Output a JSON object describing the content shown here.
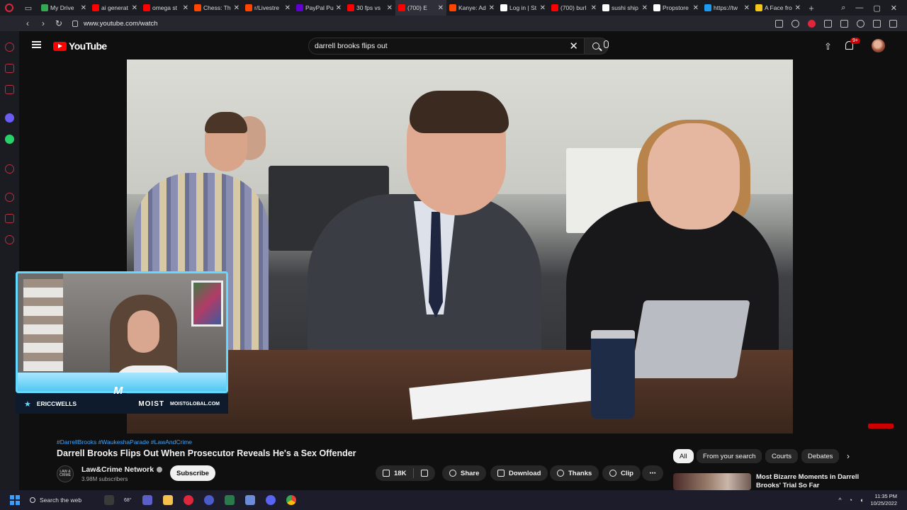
{
  "browser": {
    "tabs": [
      {
        "label": "My Drive",
        "color": "#34a853",
        "active": false
      },
      {
        "label": "ai generat",
        "color": "#ff0000",
        "active": false
      },
      {
        "label": "omega st",
        "color": "#ff0000",
        "active": false
      },
      {
        "label": "Chess: Th",
        "color": "#ff4500",
        "active": false
      },
      {
        "label": "r/Livestre",
        "color": "#ff4500",
        "active": false
      },
      {
        "label": "PayPal Pu",
        "color": "#6001d2",
        "active": false
      },
      {
        "label": "30 fps vs",
        "color": "#ff0000",
        "active": false
      },
      {
        "label": "(700) E",
        "color": "#ff0000",
        "active": true
      },
      {
        "label": "Kanye: Ad",
        "color": "#ff4500",
        "active": false
      },
      {
        "label": "Log in | St",
        "color": "#ffffff",
        "active": false
      },
      {
        "label": "(700) burl",
        "color": "#ff0000",
        "active": false
      },
      {
        "label": "sushi ship",
        "color": "#ffffff",
        "active": false
      },
      {
        "label": "Propstore",
        "color": "#ffffff",
        "active": false
      },
      {
        "label": "https://tw",
        "color": "#1d9bf0",
        "active": false
      },
      {
        "label": "A Face fro",
        "color": "#f5c518",
        "active": false
      }
    ],
    "url": "www.youtube.com/watch"
  },
  "youtube": {
    "logo_text": "YouTube",
    "search_query": "darrell brooks flips out",
    "notification_count": "9+"
  },
  "overlay": {
    "handle": "ERICCWELLS",
    "brand": "MOIST",
    "site": "MOISTGLOBAL.COM",
    "logo_letter": "M"
  },
  "video": {
    "hashtags": "#DarrellBrooks #WaukeshaParade #LawAndCrime",
    "title": "Darrell Brooks Flips Out When Prosecutor Reveals He's a Sex Offender",
    "channel_name": "Law&Crime Network",
    "channel_avatar_text": "LAW & CRIME",
    "subscribers": "3.98M subscribers",
    "subscribe_label": "Subscribe",
    "like_count": "18K",
    "share_label": "Share",
    "download_label": "Download",
    "thanks_label": "Thanks",
    "clip_label": "Clip"
  },
  "chips": [
    "All",
    "From your search",
    "Courts",
    "Debates"
  ],
  "recommendation": {
    "title": "Most Bizarre Moments in Darrell Brooks' Trial So Far"
  },
  "taskbar": {
    "search_label": "Search the web",
    "weather": "68°",
    "time": "11:35 PM",
    "date": "10/25/2022"
  }
}
